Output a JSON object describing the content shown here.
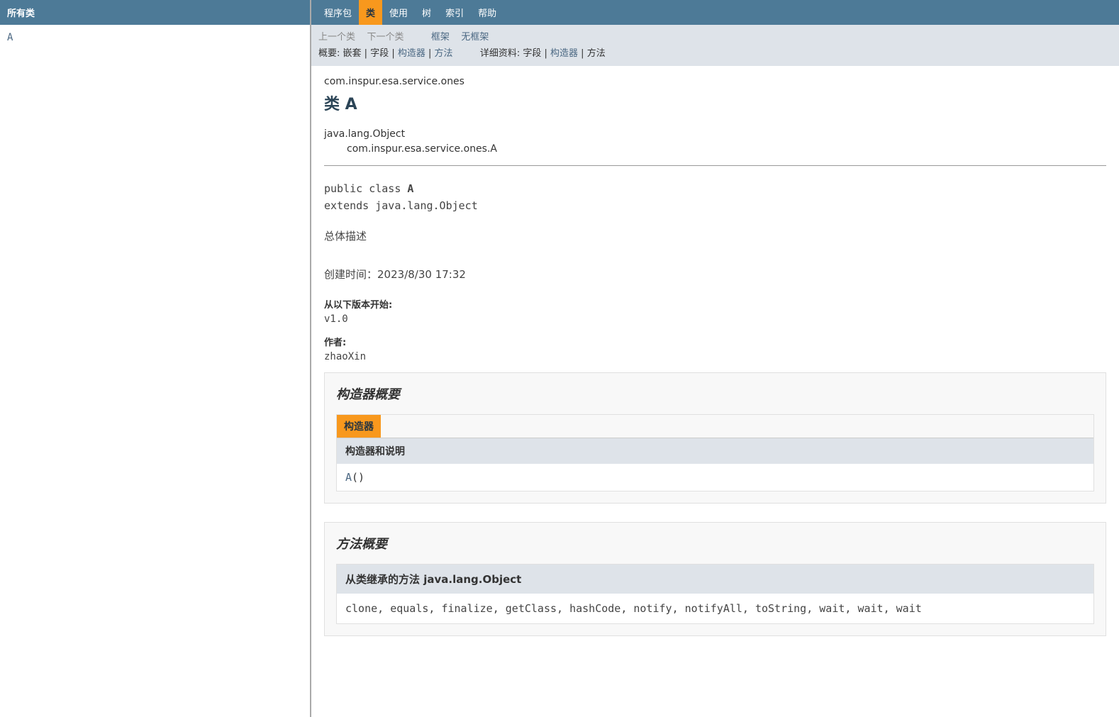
{
  "leftFrame": {
    "header": "所有类",
    "link": "A"
  },
  "topNav": {
    "items": [
      {
        "label": "程序包",
        "active": false
      },
      {
        "label": "类",
        "active": true
      },
      {
        "label": "使用",
        "active": false
      },
      {
        "label": "树",
        "active": false
      },
      {
        "label": "索引",
        "active": false
      },
      {
        "label": "帮助",
        "active": false
      }
    ]
  },
  "subNav": {
    "prevClass": "上一个类",
    "nextClass": "下一个类",
    "frames": "框架",
    "noFrames": "无框架",
    "summaryLabel": "概要: ",
    "summaryItems": {
      "nested": "嵌套",
      "field": "字段",
      "constructor": "构造器",
      "method": "方法"
    },
    "detailLabel": "详细资料: ",
    "detailItems": {
      "field": "字段",
      "constructor": "构造器",
      "method": "方法"
    }
  },
  "header": {
    "packageName": "com.inspur.esa.service.ones",
    "classPrefix": "类 ",
    "className": "A"
  },
  "inheritance": {
    "parent": "java.lang.Object",
    "self": "com.inspur.esa.service.ones.A"
  },
  "declaration": {
    "line1_prefix": "public class ",
    "line1_name": "A",
    "line2": "extends java.lang.Object"
  },
  "description": {
    "overall": "总体描述",
    "createdLabel": "创建时间：",
    "createdValue": "2023/8/30 17:32"
  },
  "meta": {
    "sinceLabel": "从以下版本开始:",
    "sinceValue": "v1.0",
    "authorLabel": "作者:",
    "authorValue": "zhaoXin"
  },
  "constructorSection": {
    "title": "构造器概要",
    "caption": "构造器",
    "columnHeader": "构造器和说明",
    "constructorName": "A",
    "constructorParens": "()"
  },
  "methodSection": {
    "title": "方法概要",
    "inheritedHeader": "从类继承的方法 java.lang.Object",
    "inheritedMethods": "clone, equals, finalize, getClass, hashCode, notify, notifyAll, toString, wait, wait, wait"
  }
}
